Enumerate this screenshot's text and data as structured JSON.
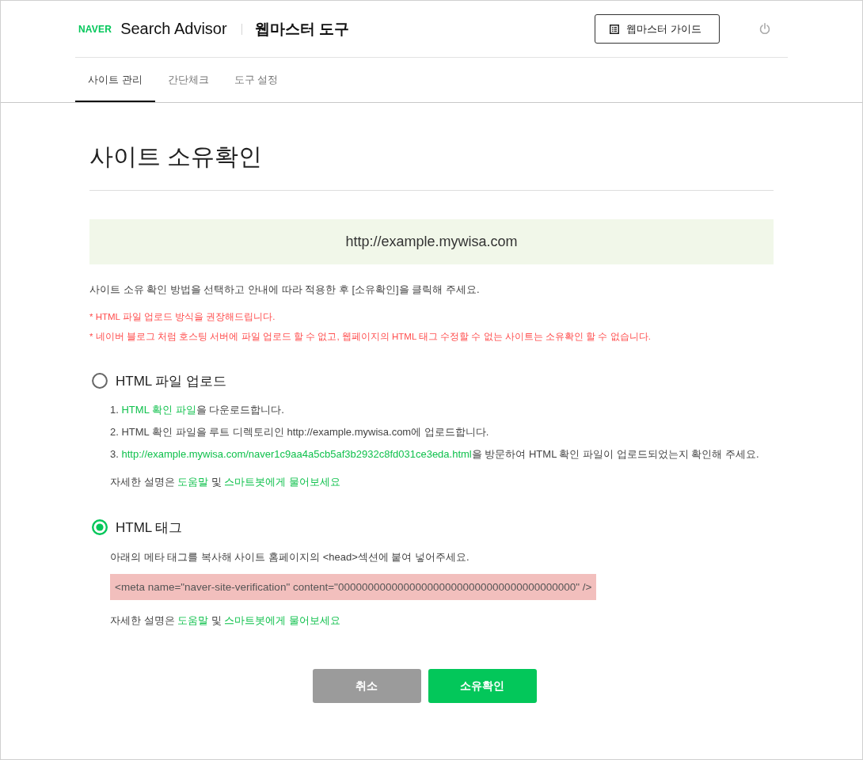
{
  "header": {
    "logo": "NAVER",
    "product": "Search Advisor",
    "tool": "웹마스터 도구",
    "guide_button": "웹마스터 가이드"
  },
  "tabs": [
    {
      "label": "사이트 관리",
      "selected": true
    },
    {
      "label": "간단체크",
      "selected": false
    },
    {
      "label": "도구 설정",
      "selected": false
    }
  ],
  "page": {
    "title": "사이트 소유확인",
    "site_url": "http://example.mywisa.com",
    "instruction": "사이트 소유 확인 방법을 선택하고 안내에 따라 적용한 후 [소유확인]을 클릭해 주세요.",
    "notes": [
      "* HTML 파일 업로드 방식을 권장해드립니다.",
      "* 네이버 블로그 처럼 호스팅 서버에 파일 업로드 할 수 없고, 웹페이지의 HTML 태그 수정할 수 없는 사이트는 소유확인 할 수 없습니다."
    ]
  },
  "methods": [
    {
      "kind": "file",
      "label": "HTML 파일 업로드",
      "selected": false,
      "steps": [
        [
          {
            "kind": "text",
            "text": "1. "
          },
          {
            "kind": "link",
            "text": "HTML 확인 파일"
          },
          {
            "kind": "text",
            "text": "을 다운로드합니다."
          }
        ],
        [
          {
            "kind": "text",
            "text": "2. HTML 확인 파일을 루트 디렉토리인 http://example.mywisa.com에 업로드합니다."
          }
        ],
        [
          {
            "kind": "text",
            "text": "3. "
          },
          {
            "kind": "link",
            "text": "http://example.mywisa.com/naver1c9aa4a5cb5af3b2932c8fd031ce3eda.html"
          },
          {
            "kind": "text",
            "text": "을 방문하여 HTML 확인 파일이 업로드되었는지 확인해 주세요."
          }
        ]
      ],
      "help": [
        {
          "kind": "text",
          "text": "자세한 설명은 "
        },
        {
          "kind": "link",
          "text": "도움말"
        },
        {
          "kind": "text",
          "text": " 및 "
        },
        {
          "kind": "link",
          "text": "스마트봇에게 물어보세요"
        }
      ]
    },
    {
      "kind": "tag",
      "label": "HTML 태그",
      "selected": true,
      "description": "아래의 메타 태그를 복사해 사이트 홈페이지의 <head>섹션에 붙여 넣어주세요.",
      "code": "<meta name=\"naver-site-verification\" content=\"0000000000000000000000000000000000000000\" />",
      "help": [
        {
          "kind": "text",
          "text": "자세한 설명은 "
        },
        {
          "kind": "link",
          "text": "도움말"
        },
        {
          "kind": "text",
          "text": " 및 "
        },
        {
          "kind": "link",
          "text": "스마트봇에게 물어보세요"
        }
      ]
    }
  ],
  "buttons": [
    {
      "kind": "cancel",
      "label": "취소"
    },
    {
      "kind": "confirm",
      "label": "소유확인"
    }
  ]
}
